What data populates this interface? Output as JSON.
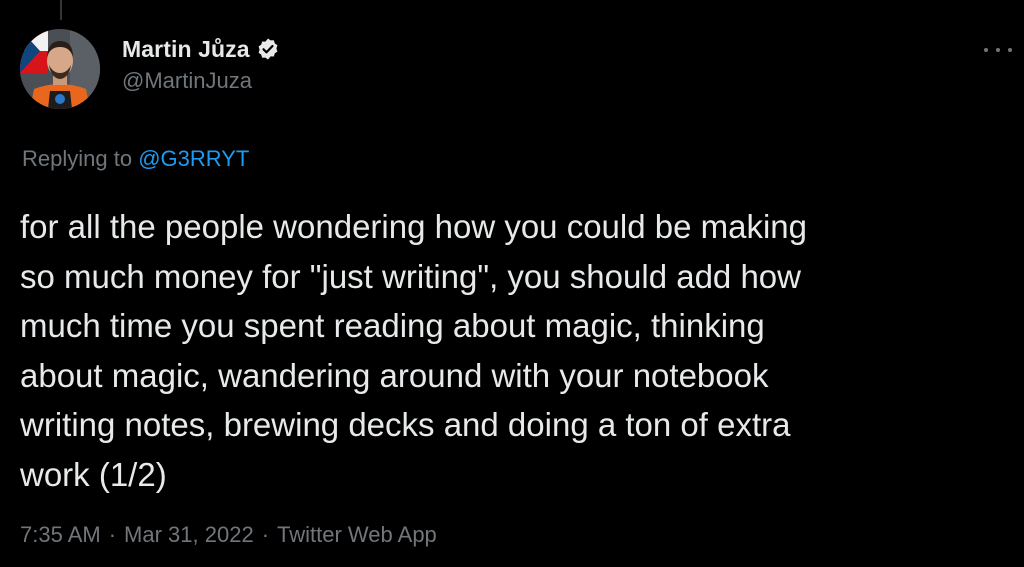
{
  "tweet": {
    "author": {
      "display_name": "Martin Jůza",
      "handle": "@MartinJuza",
      "verified": true,
      "avatar_icon": "profile-photo"
    },
    "more_icon": "more-horizontal-icon",
    "reply_context": {
      "prefix": "Replying to",
      "mention": "@G3RRYT"
    },
    "text_lines": [
      "for all the people wondering how you could be making",
      "so much money for \"just writing\", you should add how",
      "much time you spent reading about magic, thinking",
      "about magic, wandering around with your notebook",
      "writing notes, brewing decks and doing a ton of extra",
      "work (1/2)"
    ],
    "meta": {
      "time": "7:35 AM",
      "separator": "·",
      "date": "Mar 31, 2022",
      "source": "Twitter Web App"
    },
    "colors": {
      "background": "#000000",
      "text": "#e7e9ea",
      "secondary": "#71767b",
      "link": "#1d9bf0",
      "verified_badge": "#1d9bf0"
    }
  }
}
